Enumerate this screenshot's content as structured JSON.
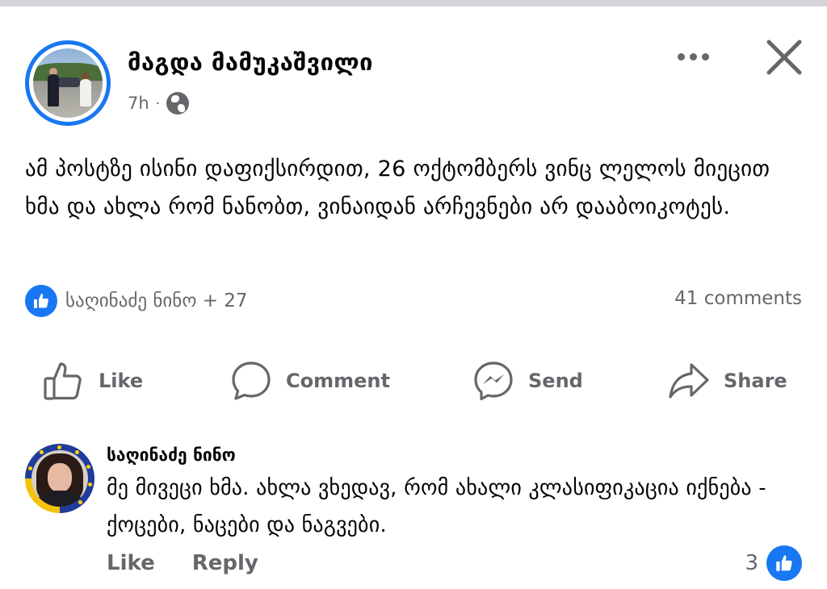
{
  "post": {
    "author_name": "მაგდა მამუკაშვილი",
    "time": "7h",
    "separator": "·",
    "privacy_icon": "globe-icon",
    "text": "ამ პოსტზე ისინი დაფიქსირდით, 26 ოქტომბერს ვინც ლელოს მიეცით ხმა და ახლა რომ ნანობთ, ვინაიდან არჩევნები არ დააბოიკოტეს.",
    "reactions_label": "საღინაძე ნინო + 27",
    "comments_label": "41 comments"
  },
  "actions": {
    "like": "Like",
    "comment": "Comment",
    "send": "Send",
    "share": "Share"
  },
  "comment": {
    "author": "საღინაძე ნინო",
    "text": "მე მივეცი ხმა. ახლა ვხედავ, რომ ახალი კლასიფიკაცია იქნება - ქოცები, ნაცები და ნაგვები.",
    "like_label": "Like",
    "reply_label": "Reply",
    "reaction_count": "3"
  },
  "colors": {
    "accent": "#1877f2",
    "secondary_text": "#65676b",
    "primary_text": "#050505"
  }
}
